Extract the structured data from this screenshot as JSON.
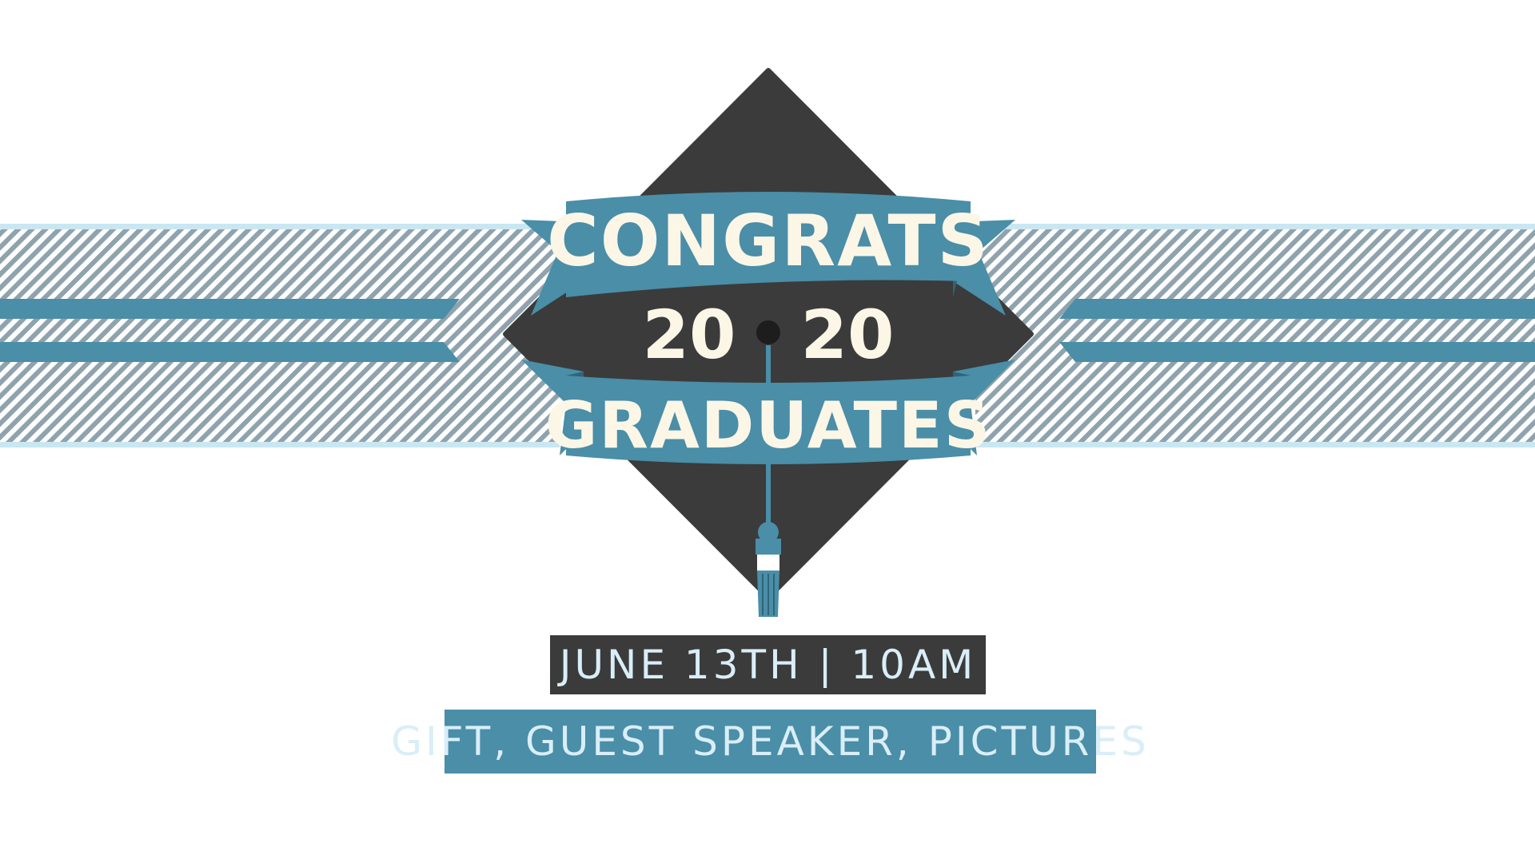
{
  "headline": {
    "top_banner": "CONGRATS",
    "year_left": "20",
    "year_right": "20",
    "bottom_banner": "GRADUATES"
  },
  "event": {
    "date_time": "JUNE 13TH | 10AM",
    "activities": "GIFT, GUEST SPEAKER, PICTURES"
  },
  "colors": {
    "teal": "#4a8ea8",
    "dark_teal": "#2f6478",
    "charcoal": "#3b3b3b",
    "cream_text": "#fbf6e6",
    "light_blue": "#c9e7f2",
    "stripe_gray": "#8fa3ae"
  },
  "icons": {
    "cap": "graduation-cap-icon",
    "tassel": "tassel-icon"
  }
}
